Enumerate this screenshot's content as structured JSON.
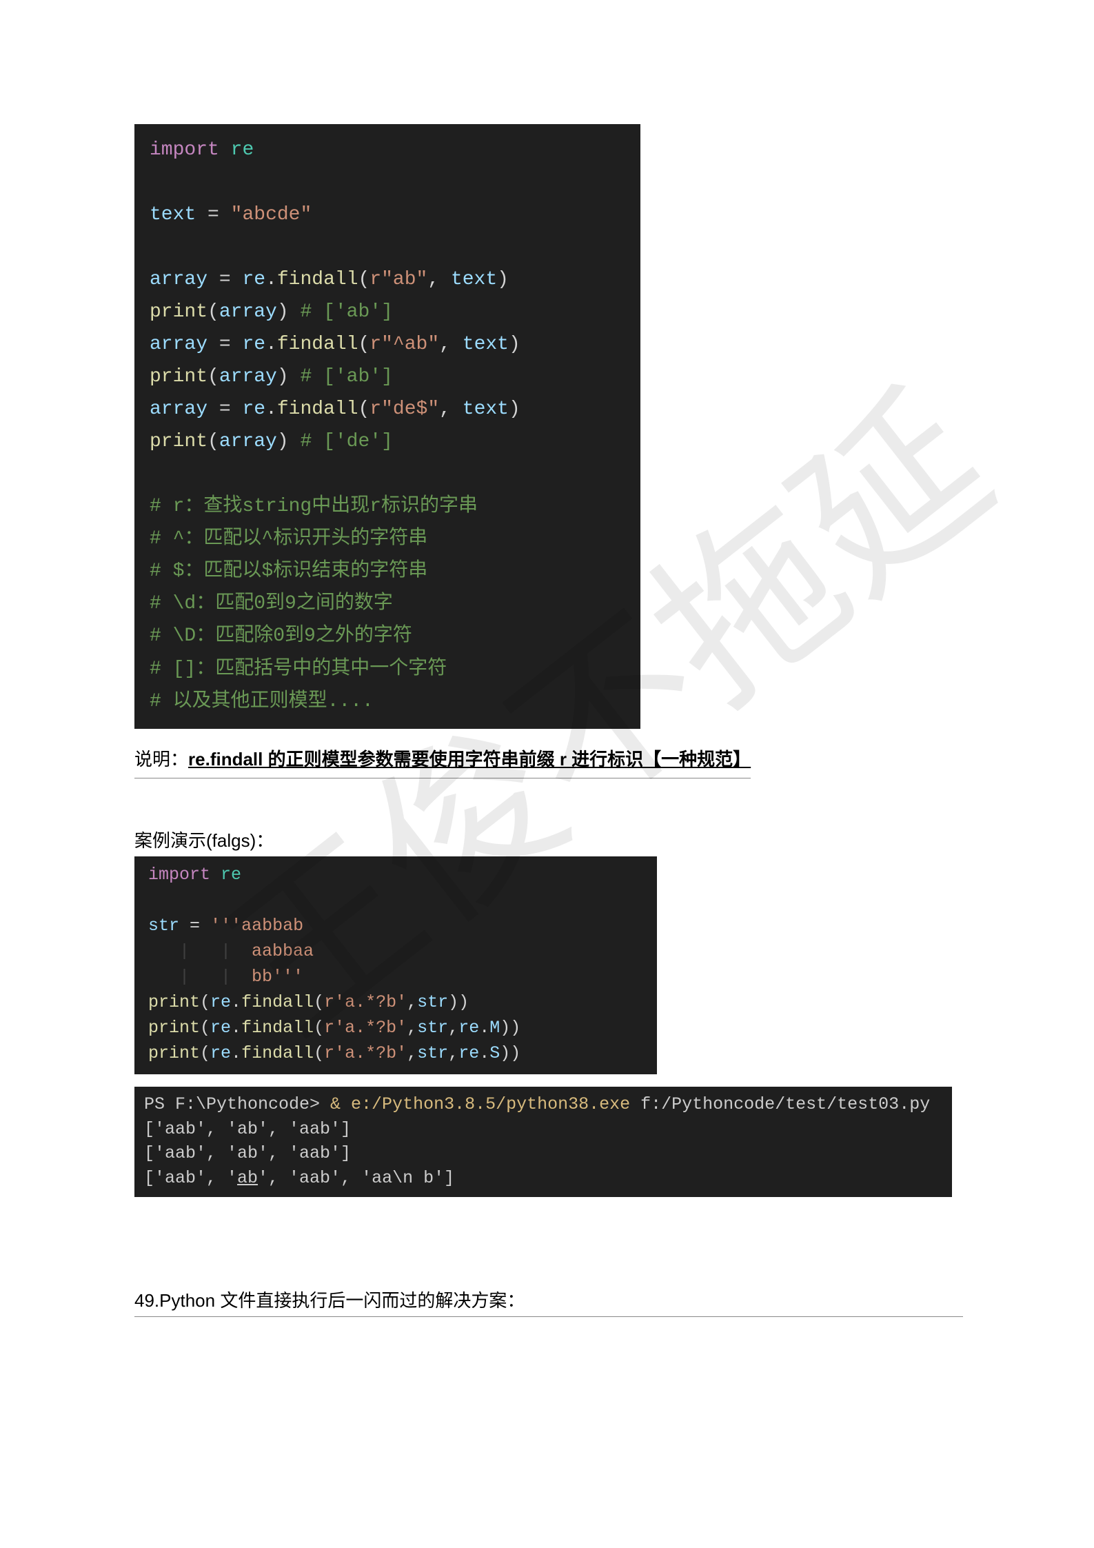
{
  "code1": {
    "l1_import": "import",
    "l1_re": "re",
    "l3_text": "text",
    "l3_eq": "=",
    "l3_str": "\"abcde\"",
    "l5_array": "array",
    "l5_eq": "=",
    "l5_re": "re",
    "l5_dot": ".",
    "l5_findall": "findall",
    "l5_open": "(",
    "l5_arg1": "r\"ab\"",
    "l5_comma": ",",
    "l5_arg2": "text",
    "l5_close": ")",
    "l6_print": "print",
    "l6_open": "(",
    "l6_arg": "array",
    "l6_close": ")",
    "l6_comment": "# ['ab']",
    "l7_array": "array",
    "l7_eq": "=",
    "l7_re": "re",
    "l7_findall": "findall",
    "l7_arg1": "r\"^ab\"",
    "l7_arg2": "text",
    "l8_print": "print",
    "l8_arg": "array",
    "l8_comment": "# ['ab']",
    "l9_array": "array",
    "l9_eq": "=",
    "l9_re": "re",
    "l9_findall": "findall",
    "l9_arg1": "r\"de$\"",
    "l9_arg2": "text",
    "l10_print": "print",
    "l10_arg": "array",
    "l10_comment": "# ['de']",
    "c1": "# r：查找string中出现r标识的字串",
    "c2": "# ^：匹配以^标识开头的字符串",
    "c3": "# $：匹配以$标识结束的字符串",
    "c4": "# \\d：匹配0到9之间的数字",
    "c5": "# \\D：匹配除0到9之外的字符",
    "c6": "# []：匹配括号中的其中一个字符",
    "c7": "# 以及其他正则模型...."
  },
  "anno_prefix": "说明：",
  "anno_bold": "re.findall 的正则模型参数需要使用字符串前缀 r 进行标识【一种规范】",
  "demo_label": "案例演示(falgs)：",
  "code2": {
    "l1_import": "import",
    "l1_re": "re",
    "l3_str": "str",
    "l3_eq": "=",
    "l3_v1": "'''aabbab",
    "l4_v": "aabbaa",
    "l5_v": "bb'''",
    "l6_print": "print",
    "l6_re": "re",
    "l6_findall": "findall",
    "l6_arg1": "r'a.*?b'",
    "l6_arg2": "str",
    "l7_print": "print",
    "l7_re": "re",
    "l7_findall": "findall",
    "l7_arg1": "r'a.*?b'",
    "l7_arg2": "str",
    "l7_arg3a": "re",
    "l7_arg3b": "M",
    "l8_print": "print",
    "l8_re": "re",
    "l8_findall": "findall",
    "l8_arg1": "r'a.*?b'",
    "l8_arg2": "str",
    "l8_arg3a": "re",
    "l8_arg3b": "S"
  },
  "terminal": {
    "prompt": "PS F:\\Pythoncode> ",
    "cmd_yellow": "& e:/Python3.8.5/python38.exe",
    "cmd_rest": " f:/Pythoncode/test/test03.py",
    "out1": "['aab', 'ab', 'aab']",
    "out2": "['aab', 'ab', 'aab']",
    "out3a": "['aab', '",
    "out3b": "ab",
    "out3c": "', 'aab', 'aa\\n          b']"
  },
  "heading49": "49.Python 文件直接执行后一闪而过的解决方案：",
  "watermark": "王俊不拖延"
}
